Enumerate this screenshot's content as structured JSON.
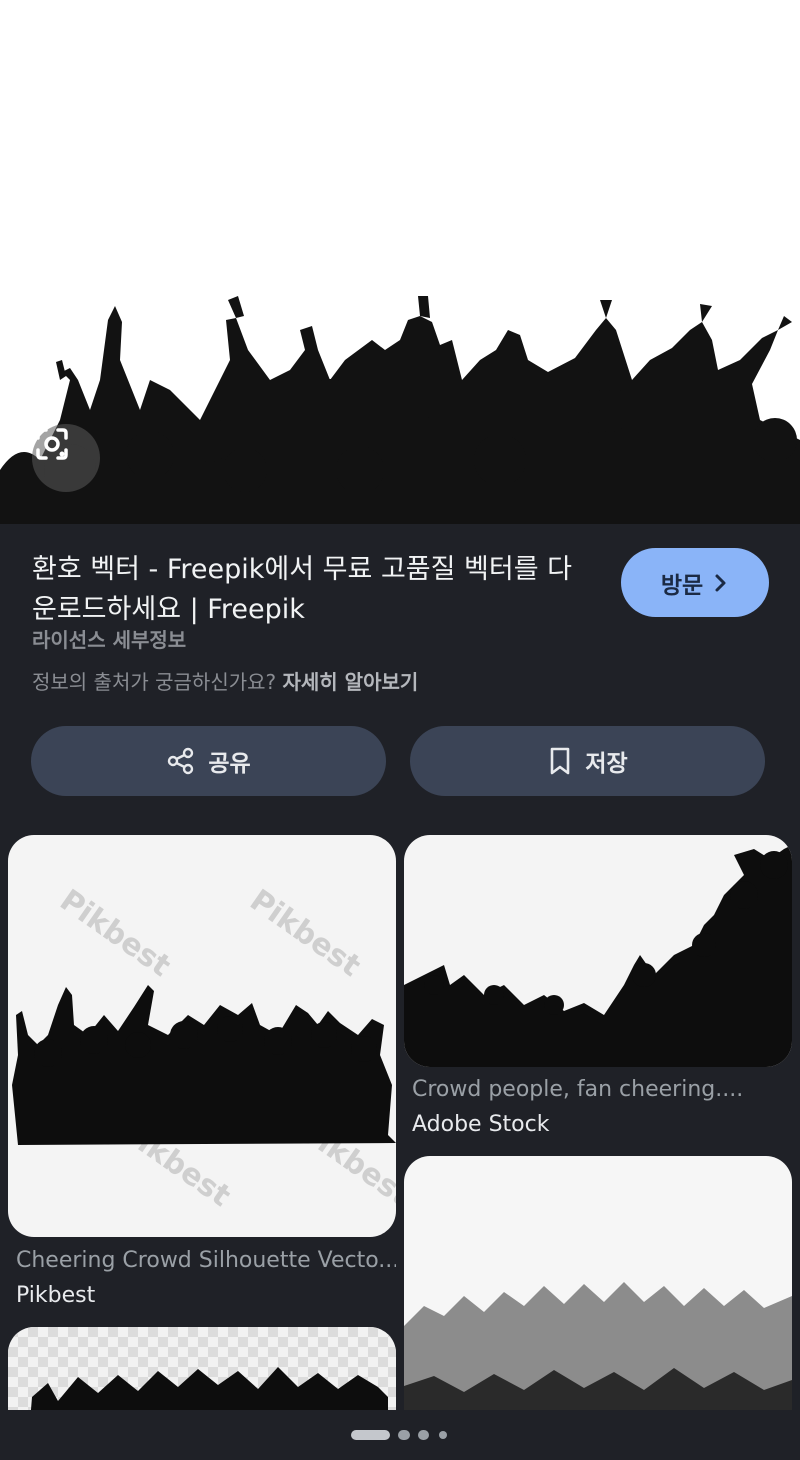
{
  "hero": {
    "lens_icon": "camera-lens-icon",
    "colors": {
      "background": "#ffffff",
      "silhouette": "#121212"
    }
  },
  "result": {
    "title": "환호 벡터 - Freepik에서 무료 고품질 벡터를 다운로드하세요 | Freepik",
    "visit_label": "방문",
    "visit_icon": "chevron-right-icon",
    "license_label": "라이선스 세부정보",
    "source_question": "정보의 출처가 궁금하신가요?",
    "source_link": "자세히 알아보기",
    "share_label": "공유",
    "share_icon": "share-icon",
    "save_label": "저장",
    "save_icon": "bookmark-icon",
    "accent_color": "#8ab4f8"
  },
  "related": [
    {
      "caption": "Cheering Crowd Silhouette Vecto...",
      "source": "Pikbest",
      "watermark": "Pikbest"
    },
    {
      "caption": "Crowd people, fan cheering....",
      "source": "Adobe Stock"
    },
    {
      "caption": "",
      "source": ""
    },
    {
      "caption": "",
      "source": ""
    }
  ],
  "pager": {
    "pages": 4,
    "active": 1
  }
}
